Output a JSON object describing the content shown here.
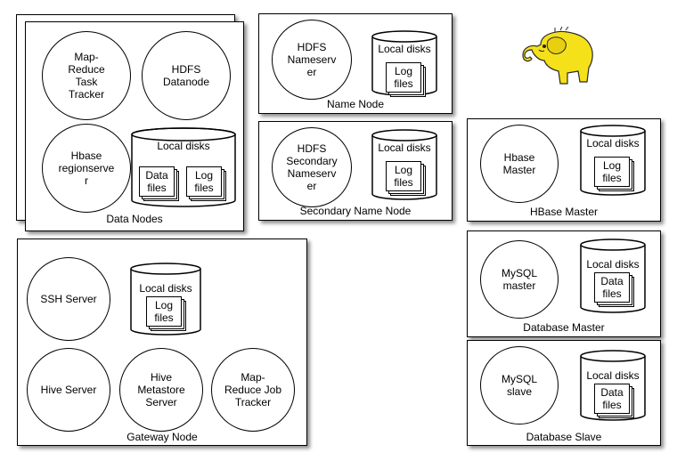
{
  "data_nodes": {
    "label": "Data Nodes",
    "tasktracker": "Map-\nReduce\nTask\nTracker",
    "datanode": "HDFS\nDatanode",
    "regionserver": "Hbase\nregionserve\nr",
    "disks": "Local disks",
    "data_files": "Data\nfiles",
    "log_files": "Log\nfiles"
  },
  "name_node": {
    "label": "Name Node",
    "nameserver": "HDFS\nNameserv\ner",
    "disks": "Local disks",
    "log_files": "Log\nfiles"
  },
  "secondary_name_node": {
    "label": "Secondary Name Node",
    "nameserver": "HDFS\nSecondary\nNameserv\ner",
    "disks": "Local disks",
    "log_files": "Log\nfiles"
  },
  "hbase_master": {
    "label": "HBase Master",
    "master": "Hbase\nMaster",
    "disks": "Local disks",
    "log_files": "Log\nfiles"
  },
  "database_master": {
    "label": "Database Master",
    "mysql": "MySQL\nmaster",
    "disks": "Local disks",
    "data_files": "Data\nfiles"
  },
  "database_slave": {
    "label": "Database Slave",
    "mysql": "MySQL\nslave",
    "disks": "Local disks",
    "data_files": "Data\nfiles"
  },
  "gateway_node": {
    "label": "Gateway Node",
    "ssh": "SSH Server",
    "hive": "Hive Server",
    "metastore": "Hive\nMetastore\nServer",
    "jobtracker": "Map-\nReduce Job\nTracker",
    "disks": "Local disks",
    "log_files": "Log\nfiles"
  },
  "logo": {
    "icon": "hadoop-elephant-icon",
    "color": "#f5e11a"
  }
}
